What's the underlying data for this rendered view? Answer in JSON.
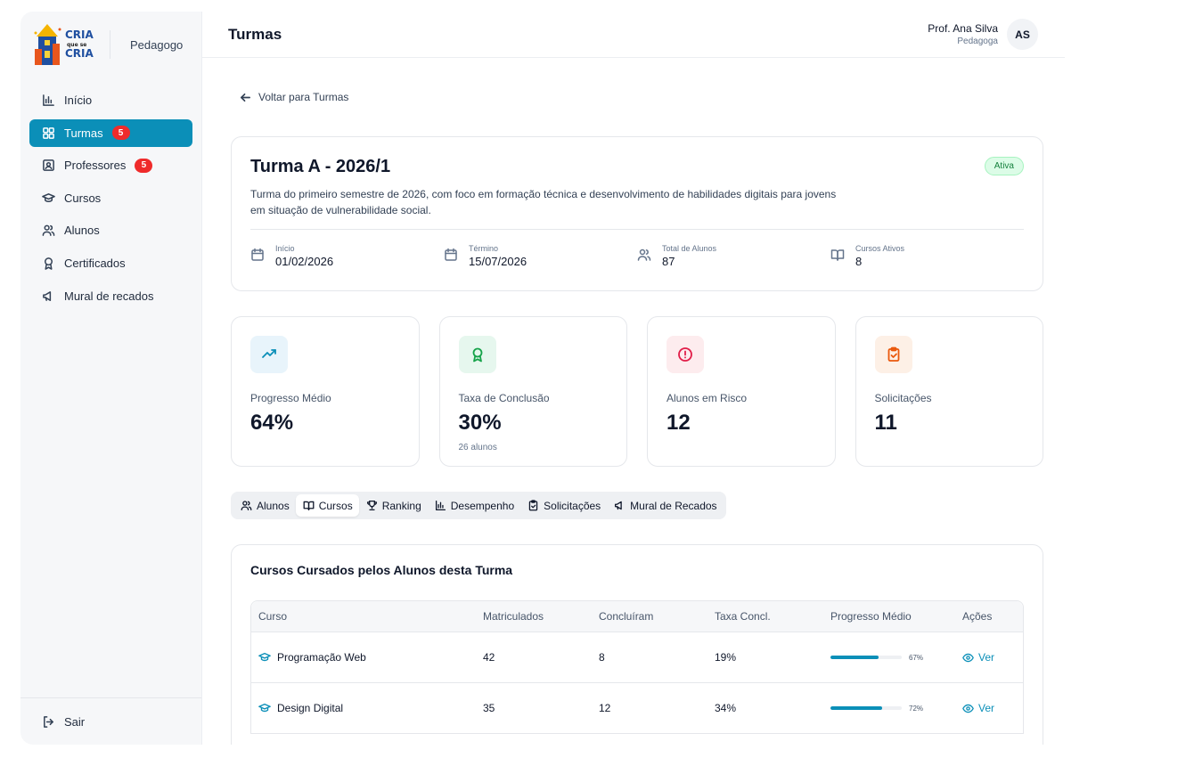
{
  "brand": {
    "logo_text_top": "CRIA",
    "logo_text_mid": "que se",
    "logo_text_bottom": "CRIA",
    "role": "Pedagogo"
  },
  "sidebar": {
    "items": [
      {
        "label": "Início",
        "icon": "bar-chart-icon",
        "active": false,
        "badge": ""
      },
      {
        "label": "Turmas",
        "icon": "grid-icon",
        "active": true,
        "badge": "5"
      },
      {
        "label": "Professores",
        "icon": "id-card-icon",
        "active": false,
        "badge": "5"
      },
      {
        "label": "Cursos",
        "icon": "graduation-cap-icon",
        "active": false,
        "badge": ""
      },
      {
        "label": "Alunos",
        "icon": "users-icon",
        "active": false,
        "badge": ""
      },
      {
        "label": "Certificados",
        "icon": "award-icon",
        "active": false,
        "badge": ""
      },
      {
        "label": "Mural de recados",
        "icon": "megaphone-icon",
        "active": false,
        "badge": ""
      }
    ],
    "logout": "Sair"
  },
  "header": {
    "title": "Turmas",
    "user_name": "Prof. Ana Silva",
    "user_role": "Pedagoga",
    "avatar": "AS"
  },
  "back_link": "Voltar para Turmas",
  "turma": {
    "title": "Turma A - 2026/1",
    "status": "Ativa",
    "description": "Turma do primeiro semestre de 2026, com foco em formação técnica e desenvolvimento de habilidades digitais para jovens em situação de vulnerabilidade social.",
    "stats": [
      {
        "label": "Início",
        "value": "01/02/2026"
      },
      {
        "label": "Término",
        "value": "15/07/2026"
      },
      {
        "label": "Total de Alunos",
        "value": "87"
      },
      {
        "label": "Cursos Ativos",
        "value": "8"
      }
    ]
  },
  "kpis": [
    {
      "label": "Progresso Médio",
      "value": "64%",
      "sub": ""
    },
    {
      "label": "Taxa de Conclusão",
      "value": "30%",
      "sub": "26 alunos"
    },
    {
      "label": "Alunos em Risco",
      "value": "12",
      "sub": ""
    },
    {
      "label": "Solicitações",
      "value": "11",
      "sub": ""
    }
  ],
  "tabs": [
    {
      "label": "Alunos"
    },
    {
      "label": "Cursos"
    },
    {
      "label": "Ranking"
    },
    {
      "label": "Desempenho"
    },
    {
      "label": "Solicitações"
    },
    {
      "label": "Mural de Recados"
    }
  ],
  "courses": {
    "title": "Cursos Cursados pelos Alunos desta Turma",
    "columns": [
      "Curso",
      "Matriculados",
      "Concluíram",
      "Taxa Concl.",
      "Progresso Médio",
      "Ações"
    ],
    "rows": [
      {
        "name": "Programação Web",
        "enrolled": "42",
        "completed": "8",
        "rate": "19%",
        "progress": 67,
        "progress_label": "67%",
        "action": "Ver"
      },
      {
        "name": "Design Digital",
        "enrolled": "35",
        "completed": "12",
        "rate": "34%",
        "progress": 72,
        "progress_label": "72%",
        "action": "Ver"
      }
    ]
  },
  "colors": {
    "accent": "#0b8fb8",
    "badge": "#ef2b2b",
    "success": "#15803d"
  }
}
